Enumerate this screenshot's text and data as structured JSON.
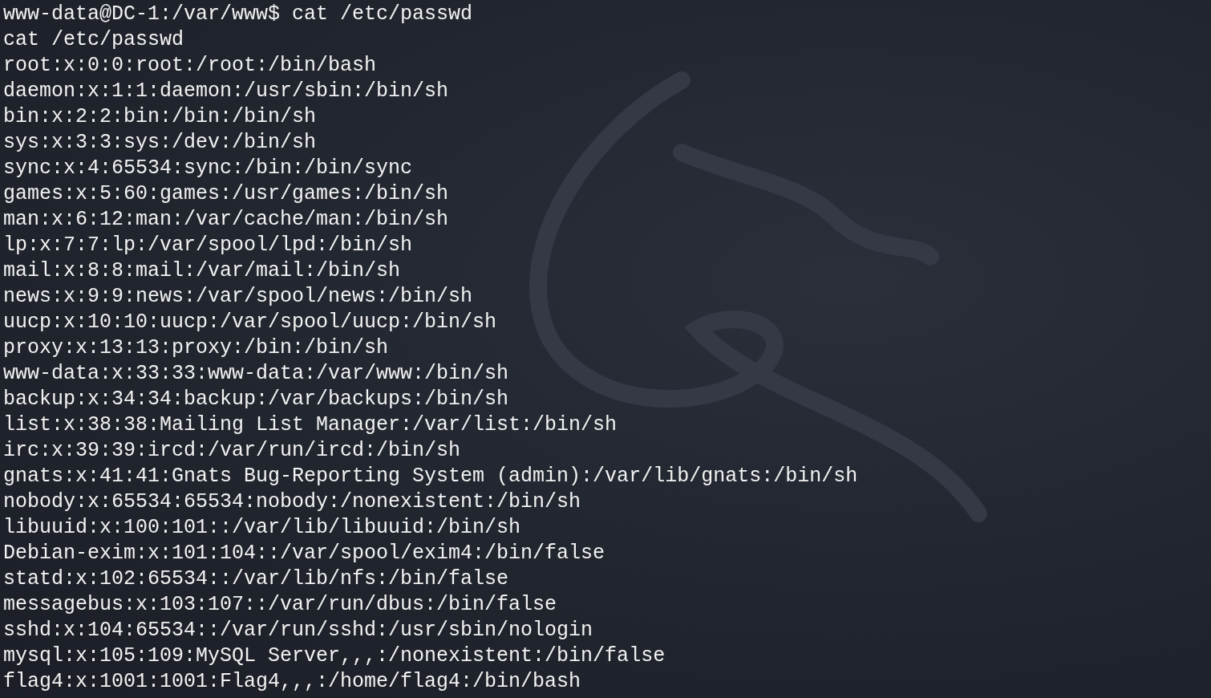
{
  "terminal": {
    "prompt": "www-data@DC-1:/var/www$",
    "command": "cat /etc/passwd",
    "output": [
      "cat /etc/passwd",
      "root:x:0:0:root:/root:/bin/bash",
      "daemon:x:1:1:daemon:/usr/sbin:/bin/sh",
      "bin:x:2:2:bin:/bin:/bin/sh",
      "sys:x:3:3:sys:/dev:/bin/sh",
      "sync:x:4:65534:sync:/bin:/bin/sync",
      "games:x:5:60:games:/usr/games:/bin/sh",
      "man:x:6:12:man:/var/cache/man:/bin/sh",
      "lp:x:7:7:lp:/var/spool/lpd:/bin/sh",
      "mail:x:8:8:mail:/var/mail:/bin/sh",
      "news:x:9:9:news:/var/spool/news:/bin/sh",
      "uucp:x:10:10:uucp:/var/spool/uucp:/bin/sh",
      "proxy:x:13:13:proxy:/bin:/bin/sh",
      "www-data:x:33:33:www-data:/var/www:/bin/sh",
      "backup:x:34:34:backup:/var/backups:/bin/sh",
      "list:x:38:38:Mailing List Manager:/var/list:/bin/sh",
      "irc:x:39:39:ircd:/var/run/ircd:/bin/sh",
      "gnats:x:41:41:Gnats Bug-Reporting System (admin):/var/lib/gnats:/bin/sh",
      "nobody:x:65534:65534:nobody:/nonexistent:/bin/sh",
      "libuuid:x:100:101::/var/lib/libuuid:/bin/sh",
      "Debian-exim:x:101:104::/var/spool/exim4:/bin/false",
      "statd:x:102:65534::/var/lib/nfs:/bin/false",
      "messagebus:x:103:107::/var/run/dbus:/bin/false",
      "sshd:x:104:65534::/var/run/sshd:/usr/sbin/nologin",
      "mysql:x:105:109:MySQL Server,,,:/nonexistent:/bin/false",
      "flag4:x:1001:1001:Flag4,,,:/home/flag4:/bin/bash"
    ]
  }
}
